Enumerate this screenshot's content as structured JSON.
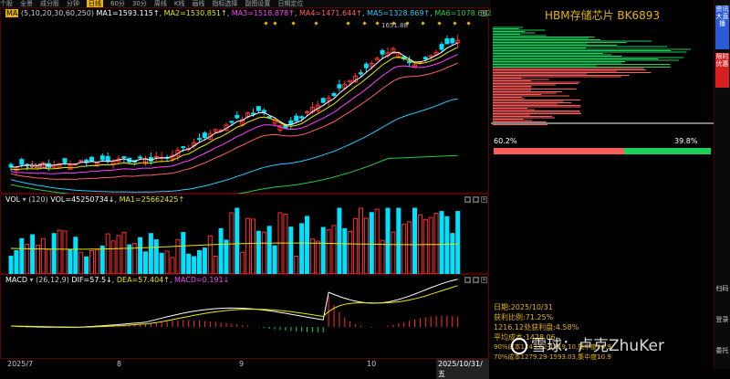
{
  "toolbar": {
    "items": [
      "个股",
      "全景",
      "成分股",
      "",
      "",
      "",
      "",
      "分钟",
      "日线",
      "60分",
      "30分",
      "周线",
      "",
      "",
      "",
      "K线",
      "画线",
      "指标选择",
      "副图设置",
      "",
      "日期定位",
      "",
      "",
      "",
      ""
    ],
    "active": "日线"
  },
  "main_legend": {
    "tag": "MA",
    "params": "(5,10,20,30,60,250)",
    "ma1": "MA1=1593.115↑",
    "ma2": "MA2=1530.851↑",
    "ma3": "MA3=1518.878↑",
    "ma4": "MA4=1471.644↑",
    "ma5": "MA5=1328.869↑",
    "ma6": "MA6=1078.602↑",
    "colors": {
      "ma1": "#ffffff",
      "ma2": "#e8e800",
      "ma3": "#ff40ff",
      "ma4": "#ff6060",
      "ma5": "#22ccff",
      "ma6": "#22cc44"
    }
  },
  "price_labels": {
    "high": "1651.88",
    "low": "1615.13"
  },
  "vol_legend": {
    "tag": "VOL",
    "params": "(120)",
    "vol": "VOL=45250734↓",
    "ma1": "MA1=25662425↑"
  },
  "macd_legend": {
    "tag": "MACD",
    "params": "(26,12,9)",
    "dif": "DIF=57.5↓",
    "dea": "DEA=57.404↑",
    "macd": "MACD=0.191↓"
  },
  "x_axis": {
    "labels": [
      "2025/7",
      "8",
      "9",
      "10",
      "2025/10/31/五"
    ]
  },
  "right_panel": {
    "title": "HBM存储芯片",
    "code": "BK6893",
    "pct_left": "60.2%",
    "pct_right": "39.8%",
    "info_lines": [
      "日期:2025/10/31",
      "获利比例:71.25%",
      "1216.12处获利盘:4.58%",
      "平均成本:1428.06",
      "90%成本1243.62-1619.10,集中度14.9",
      "70%成本1279.29-1593.03,集中度10.9"
    ]
  },
  "sidebar": {
    "btn1": "资讯大直播",
    "btn2": "限时优惠",
    "btn3": "扫码",
    "btn4": "登录",
    "btn5": "委托"
  },
  "watermark": "雪球：卢克ZhuKer"
}
